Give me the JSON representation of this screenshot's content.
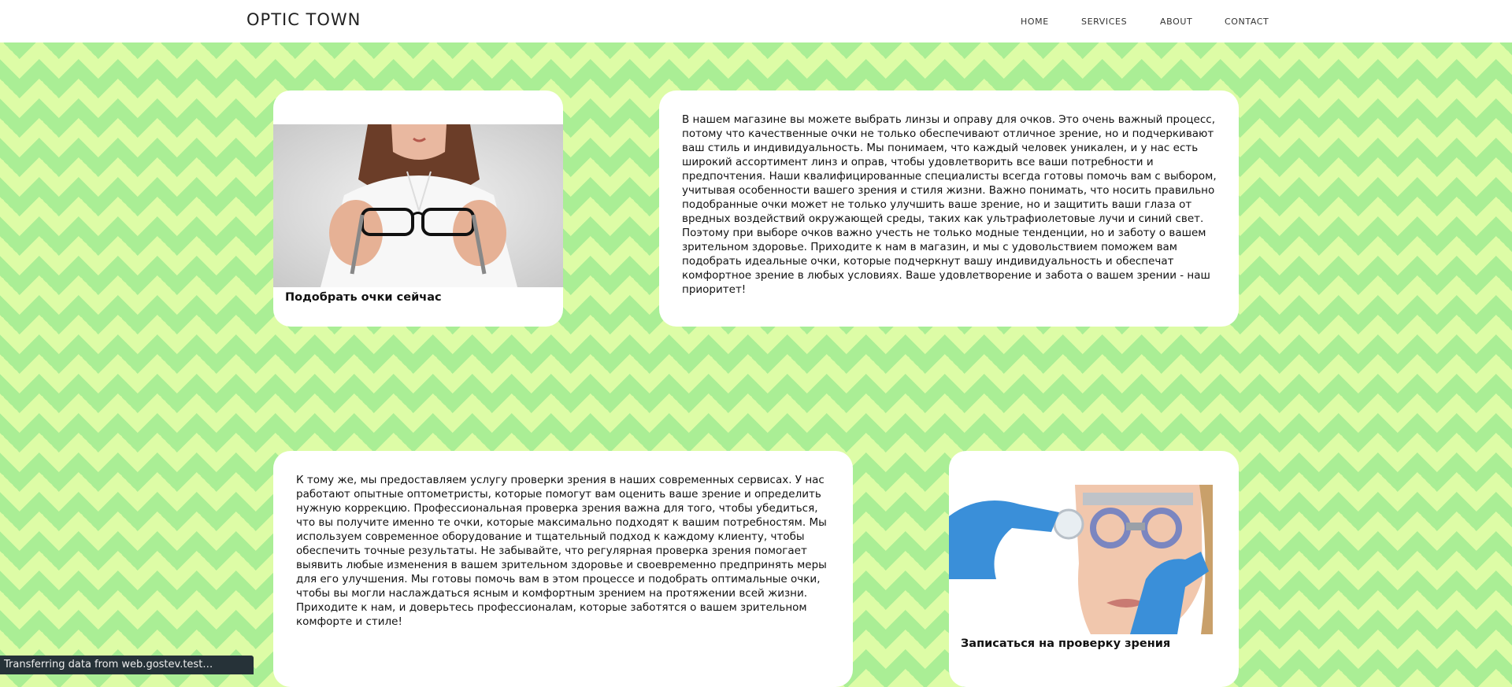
{
  "navbar": {
    "brand": "OPTIC TOWN",
    "links": [
      "HOME",
      "SERVICES",
      "ABOUT",
      "CONTACT"
    ]
  },
  "section1": {
    "image_alt": "Woman holding eyeglasses",
    "caption": "Подобрать очки сейчас",
    "text": "В нашем магазине вы можете выбрать линзы и оправу для очков. Это очень важный процесс, потому что качественные очки не только обеспечивают отличное зрение, но и подчеркивают ваш стиль и индивидуальность. Мы понимаем, что каждый человек уникален, и у нас есть широкий ассортимент линз и оправ, чтобы удовлетворить все ваши потребности и предпочтения. Наши квалифицированные специалисты всегда готовы помочь вам с выбором, учитывая особенности вашего зрения и стиля жизни. Важно понимать, что носить правильно подобранные очки может не только улучшить ваше зрение, но и защитить ваши глаза от вредных воздействий окружающей среды, таких как ультрафиолетовые лучи и синий свет. Поэтому при выборе очков важно учесть не только модные тенденции, но и заботу о вашем зрительном здоровье. Приходите к нам в магазин, и мы с удовольствием поможем вам подобрать идеальные очки, которые подчеркнут вашу индивидуальность и обеспечат комфортное зрение в любых условиях. Ваше удовлетворение и забота о вашем зрении - наш приоритет!"
  },
  "section2": {
    "text": "К тому же, мы предоставляем услугу проверки зрения в наших современных сервисах. У нас работают опытные оптометристы, которые помогут вам оценить ваше зрение и определить нужную коррекцию. Профессиональная проверка зрения важна для того, чтобы убедиться, что вы получите именно те очки, которые максимально подходят к вашим потребностям. Мы используем современное оборудование и тщательный подход к каждому клиенту, чтобы обеспечить точные результаты. Не забывайте, что регулярная проверка зрения помогает выявить любые изменения в вашем зрительном здоровье и своевременно предпринять меры для его улучшения. Мы готовы помочь вам в этом процессе и подобрать оптимальные очки, чтобы вы могли наслаждаться ясным и комфортным зрением на протяжении всей жизни. Приходите к нам, и доверьтесь профессионалам, которые заботятся о вашем зрительном комфорте и стиле!",
    "image_alt": "Eye examination with trial frame",
    "caption": "Записаться на проверку зрения"
  },
  "status_bar": {
    "text": "Transferring data from web.gostev.test…"
  },
  "colors": {
    "bg_light": "#ddfca6",
    "bg_dark": "#aaee95",
    "card": "#ffffff"
  }
}
